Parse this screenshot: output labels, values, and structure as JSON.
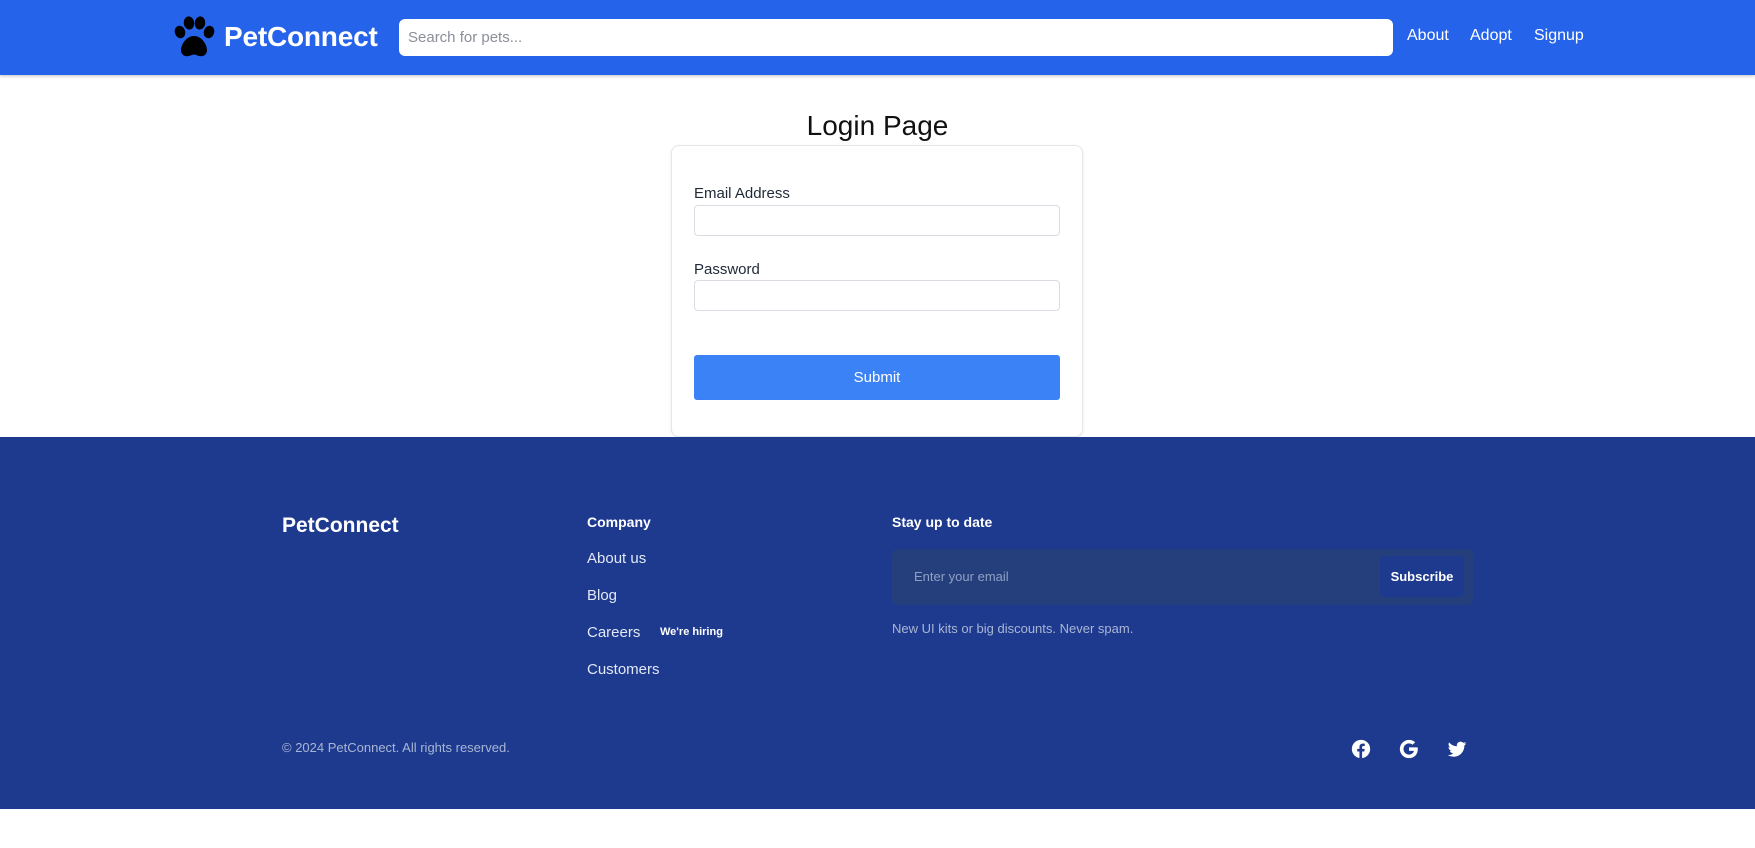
{
  "header": {
    "brand": "PetConnect",
    "search_placeholder": "Search for pets...",
    "nav": [
      "About",
      "Adopt",
      "Signup"
    ],
    "logo_icon": "paw-icon"
  },
  "login": {
    "title": "Login Page",
    "email_label": "Email Address",
    "email_value": "",
    "password_label": "Password",
    "password_value": "",
    "submit_label": "Submit"
  },
  "footer": {
    "brand": "PetConnect",
    "company_heading": "Company",
    "company_links": [
      "About us",
      "Blog",
      "Careers",
      "Customers"
    ],
    "hiring_badge": "We're hiring",
    "newsletter_heading": "Stay up to date",
    "email_placeholder": "Enter your email",
    "subscribe_label": "Subscribe",
    "newsletter_note": "New UI kits or big discounts. Never spam.",
    "copyright": "© 2024 PetConnect. All rights reserved.",
    "social_icons": [
      "facebook-icon",
      "google-icon",
      "twitter-icon"
    ]
  },
  "colors": {
    "header_bg": "#2563eb",
    "footer_bg": "#1e3a8f",
    "submit_bg": "#3b82f6"
  }
}
